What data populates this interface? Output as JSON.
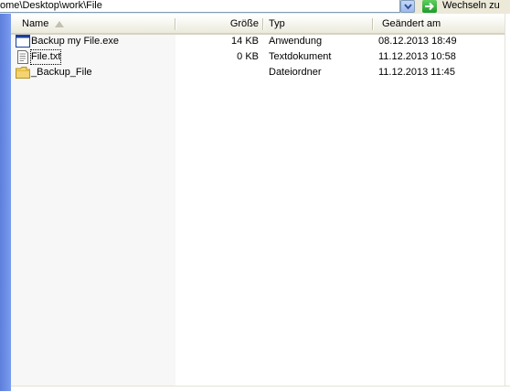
{
  "address": {
    "path": "ome\\Desktop\\work\\File",
    "go_label": "Wechseln zu"
  },
  "icons": {
    "dropdown": "chevron-down-icon",
    "go": "green-arrow-icon",
    "exe": "application-window-icon",
    "txt": "text-document-icon",
    "folder": "folder-icon"
  },
  "columns": [
    {
      "label": "Name"
    },
    {
      "label": "Größe"
    },
    {
      "label": "Typ"
    },
    {
      "label": "Geändert am"
    }
  ],
  "files": [
    {
      "name": "Backup my File.exe",
      "size": "14 KB",
      "type": "Anwendung",
      "modified": "08.12.2013 18:49"
    },
    {
      "name": "File.txt",
      "size": "0 KB",
      "type": "Textdokument",
      "modified": "11.12.2013 10:58"
    },
    {
      "name": "_Backup_File",
      "size": "",
      "type": "Dateiordner",
      "modified": "11.12.2013 11:45"
    }
  ],
  "colors": {
    "left_pane": "#6b8ee6",
    "selected_col_bg": "#f7f7f7",
    "go_green": "#2aa632"
  }
}
